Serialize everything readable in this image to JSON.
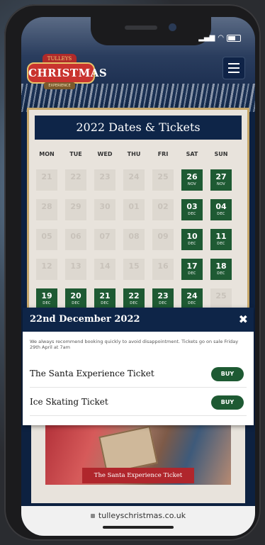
{
  "status_bar": {
    "signal": "••ll",
    "wifi": "wifi",
    "battery": "battery"
  },
  "header": {
    "logo_top": "TULLEYS",
    "logo_main": "CHRISTMAS",
    "logo_sub": "EXPERIENCE",
    "menu_icon": "hamburger-menu-icon"
  },
  "calendar": {
    "title": "2022 Dates & Tickets",
    "weekdays": [
      "MON",
      "TUE",
      "WED",
      "THU",
      "FRI",
      "SAT",
      "SUN"
    ],
    "rows": [
      [
        {
          "n": "21",
          "m": "",
          "on": false
        },
        {
          "n": "22",
          "m": "",
          "on": false
        },
        {
          "n": "23",
          "m": "",
          "on": false
        },
        {
          "n": "24",
          "m": "",
          "on": false
        },
        {
          "n": "25",
          "m": "",
          "on": false
        },
        {
          "n": "26",
          "m": "NOV",
          "on": true
        },
        {
          "n": "27",
          "m": "NOV",
          "on": true
        }
      ],
      [
        {
          "n": "28",
          "m": "",
          "on": false
        },
        {
          "n": "29",
          "m": "",
          "on": false
        },
        {
          "n": "30",
          "m": "",
          "on": false
        },
        {
          "n": "01",
          "m": "",
          "on": false
        },
        {
          "n": "02",
          "m": "",
          "on": false
        },
        {
          "n": "03",
          "m": "DEC",
          "on": true
        },
        {
          "n": "04",
          "m": "DEC",
          "on": true
        }
      ],
      [
        {
          "n": "05",
          "m": "",
          "on": false
        },
        {
          "n": "06",
          "m": "",
          "on": false
        },
        {
          "n": "07",
          "m": "",
          "on": false
        },
        {
          "n": "08",
          "m": "",
          "on": false
        },
        {
          "n": "09",
          "m": "",
          "on": false
        },
        {
          "n": "10",
          "m": "DEC",
          "on": true
        },
        {
          "n": "11",
          "m": "DEC",
          "on": true
        }
      ],
      [
        {
          "n": "12",
          "m": "",
          "on": false
        },
        {
          "n": "13",
          "m": "",
          "on": false
        },
        {
          "n": "14",
          "m": "",
          "on": false
        },
        {
          "n": "15",
          "m": "",
          "on": false
        },
        {
          "n": "16",
          "m": "",
          "on": false
        },
        {
          "n": "17",
          "m": "DEC",
          "on": true
        },
        {
          "n": "18",
          "m": "DEC",
          "on": true
        }
      ],
      [
        {
          "n": "19",
          "m": "DEC",
          "on": true
        },
        {
          "n": "20",
          "m": "DEC",
          "on": true
        },
        {
          "n": "21",
          "m": "DEC",
          "on": true
        },
        {
          "n": "22",
          "m": "DEC",
          "on": true
        },
        {
          "n": "23",
          "m": "DEC",
          "on": true
        },
        {
          "n": "24",
          "m": "DEC",
          "on": true
        },
        {
          "n": "25",
          "m": "",
          "on": false
        }
      ]
    ]
  },
  "modal": {
    "title": "22nd December 2022",
    "close": "✖",
    "note": "We always recommend booking quickly to avoid disappointment. Tickets go on sale Friday 29th April at 7am",
    "tickets": [
      {
        "name": "The Santa Experience Ticket",
        "button": "BUY"
      },
      {
        "name": "Ice Skating Ticket",
        "button": "BUY"
      }
    ]
  },
  "feature": {
    "caption": "The Santa Experience Ticket"
  },
  "browser": {
    "url": "tulleyschristmas.co.uk"
  }
}
